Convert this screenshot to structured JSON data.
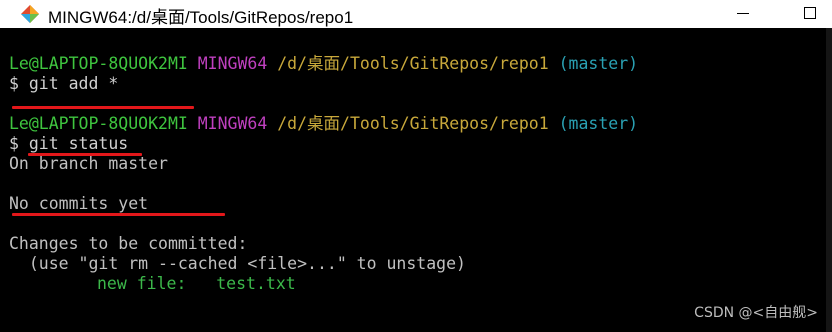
{
  "window": {
    "title": "MINGW64:/d/桌面/Tools/GitRepos/repo1",
    "icon": "git-bash-diamond-icon"
  },
  "colors": {
    "user": "#3fc53f",
    "env": "#bf40bf",
    "path": "#c8a83b",
    "branch": "#2aa1b3",
    "annotation": "#e3171a"
  },
  "prompt1": {
    "user": "Le@LAPTOP-8QUOK2MI",
    "env": "MINGW64",
    "path": "/d/桌面/Tools/GitRepos/repo1",
    "branch": "(master)"
  },
  "cmd1": "$ git add *",
  "prompt2": {
    "user": "Le@LAPTOP-8QUOK2MI",
    "env": "MINGW64",
    "path": "/d/桌面/Tools/GitRepos/repo1",
    "branch": "(master)"
  },
  "cmd2": "$ git status",
  "output": {
    "line1": "On branch master",
    "line2": "No commits yet",
    "line3": "Changes to be committed:",
    "line4": "  (use \"git rm --cached <file>...\" to unstage)",
    "newfile_label": "new file:",
    "newfile_name": "test.txt"
  },
  "watermark": "CSDN @<自由舰>"
}
